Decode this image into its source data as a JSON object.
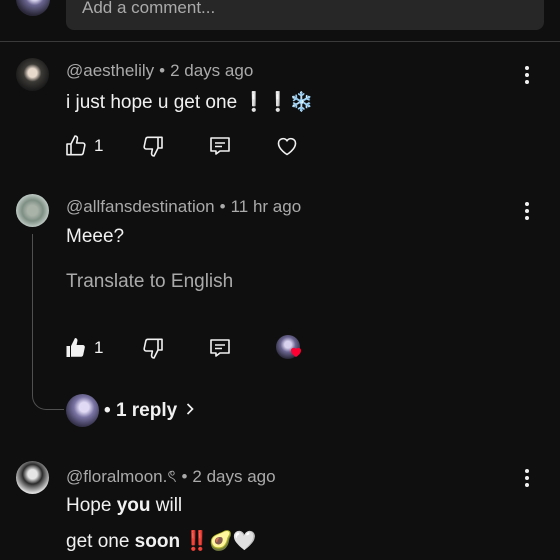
{
  "composer": {
    "placeholder": "Add a comment..."
  },
  "comments": [
    {
      "handle": "@aesthelily",
      "time": "2 days ago",
      "text": "i just hope u get one ❕❕❄️",
      "likes": "1"
    },
    {
      "handle": "@allfansdestination",
      "time": "11 hr ago",
      "text": "Meee?",
      "translate": "Translate to English",
      "likes": "1",
      "replies": "1 reply"
    },
    {
      "handle": "@floralmoon.ৎ",
      "time": "2 days ago",
      "line1_prefix": "Hope ",
      "line1_bold": "you",
      "line1_suffix": " will",
      "line2_prefix": "get one ",
      "line2_bold": "soon",
      "line2_suffix": "  ‼️🥑🤍"
    }
  ],
  "separator": "•",
  "icons": [
    "thumb-up-icon",
    "thumb-down-icon",
    "reply-icon",
    "heart-icon",
    "more-vert-icon",
    "chevron-right-icon"
  ],
  "colors": {
    "background": "#0f0f0f",
    "secondary_text": "#aaaaaa",
    "heart": "#ff0033"
  }
}
